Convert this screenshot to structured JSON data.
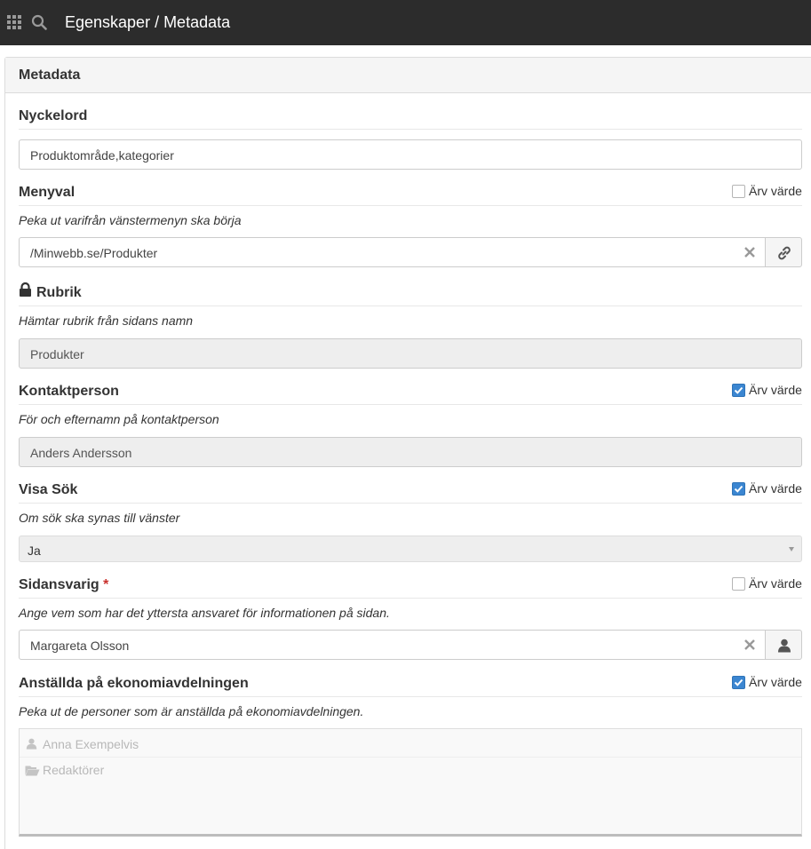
{
  "topbar": {
    "icons": [
      "grid-icon",
      "search-icon"
    ],
    "title": "Egenskaper / Metadata"
  },
  "panel": {
    "title": "Metadata"
  },
  "fields": {
    "keywords": {
      "label": "Nyckelord",
      "value": "Produktområde,kategorier"
    },
    "menu": {
      "label": "Menyval",
      "inherit_label": "Ärv värde",
      "inherit_checked": false,
      "help": "Peka ut varifrån vänstermenyn ska börja",
      "value": "/Minwebb.se/Produkter",
      "clear_icon": "close-icon",
      "addon_icon": "link-icon"
    },
    "heading": {
      "label": "Rubrik",
      "icon": "lock-icon",
      "help": "Hämtar rubrik från sidans namn",
      "value": "Produkter"
    },
    "contact": {
      "label": "Kontaktperson",
      "inherit_label": "Ärv värde",
      "inherit_checked": true,
      "help": "För och efternamn på kontaktperson",
      "value": "Anders Andersson"
    },
    "search": {
      "label": "Visa Sök",
      "inherit_label": "Ärv värde",
      "inherit_checked": true,
      "help": "Om sök ska synas till vänster",
      "value": "Ja"
    },
    "owner": {
      "label": "Sidansvarig",
      "required_mark": "*",
      "inherit_label": "Ärv värde",
      "inherit_checked": false,
      "help": "Ange vem som har det yttersta ansvaret för informationen på sidan.",
      "value": "Margareta Olsson",
      "clear_icon": "close-icon",
      "addon_icon": "user-icon"
    },
    "staff": {
      "label": "Anställda på ekonomiavdelningen",
      "inherit_label": "Ärv värde",
      "inherit_checked": true,
      "help": "Peka ut de personer som är anställda på ekonomiavdelningen.",
      "items": [
        {
          "icon": "user-icon",
          "text": "Anna Exempelvis"
        },
        {
          "icon": "folder-open-icon",
          "text": "Redaktörer"
        }
      ]
    }
  },
  "colors": {
    "topbar_bg": "#2c2c2c",
    "checkbox_checked": "#3b86d1",
    "required": "#c9302c"
  }
}
